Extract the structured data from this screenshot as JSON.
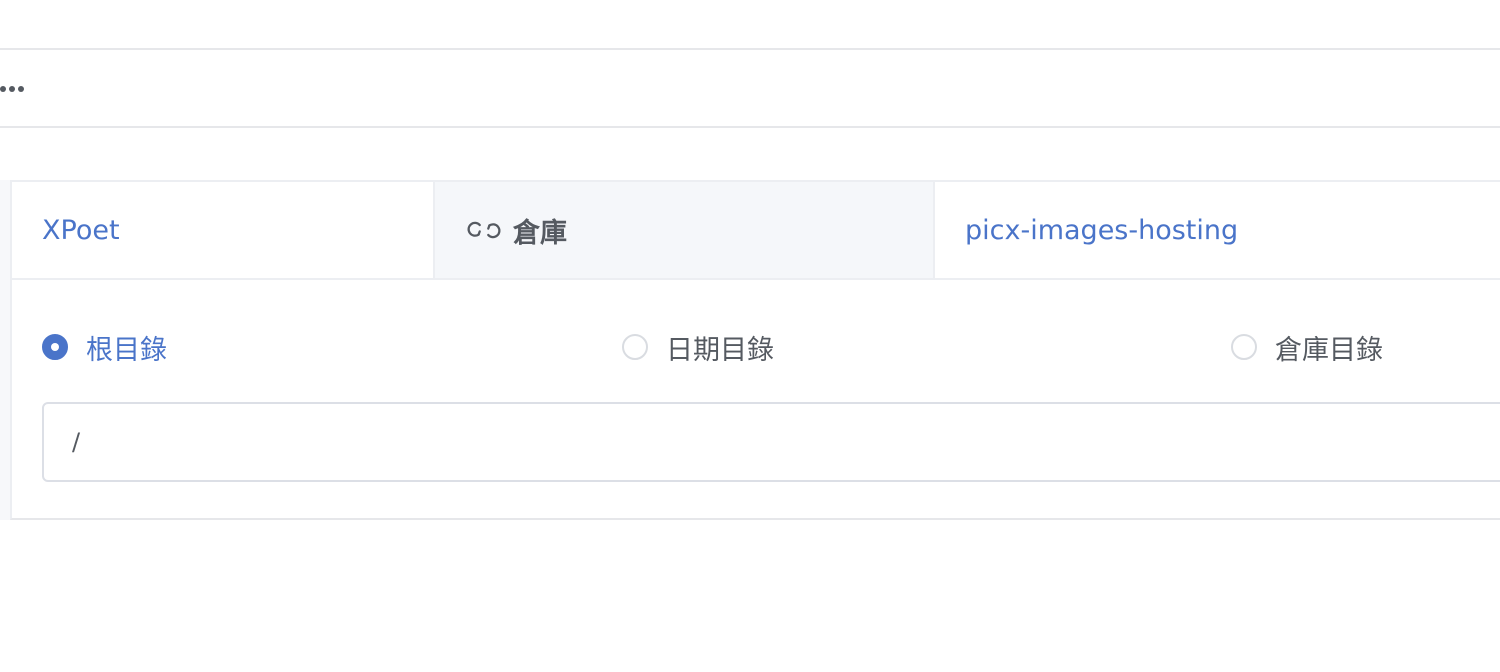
{
  "toolbar": {
    "more_icon": "more-horizontal-icon"
  },
  "repo_info": {
    "owner": "XPoet",
    "label": "倉庫",
    "label_icon": "link-chain-icon",
    "repo_name": "picx-images-hosting"
  },
  "directory_mode": {
    "options": [
      {
        "label": "根目錄",
        "selected": true
      },
      {
        "label": "日期目錄",
        "selected": false
      },
      {
        "label": "倉庫目錄",
        "selected": false
      }
    ]
  },
  "path_input": {
    "value": "/"
  },
  "colors": {
    "accent": "#4a74c9",
    "text": "#555a61",
    "border": "#dcdfe6"
  }
}
